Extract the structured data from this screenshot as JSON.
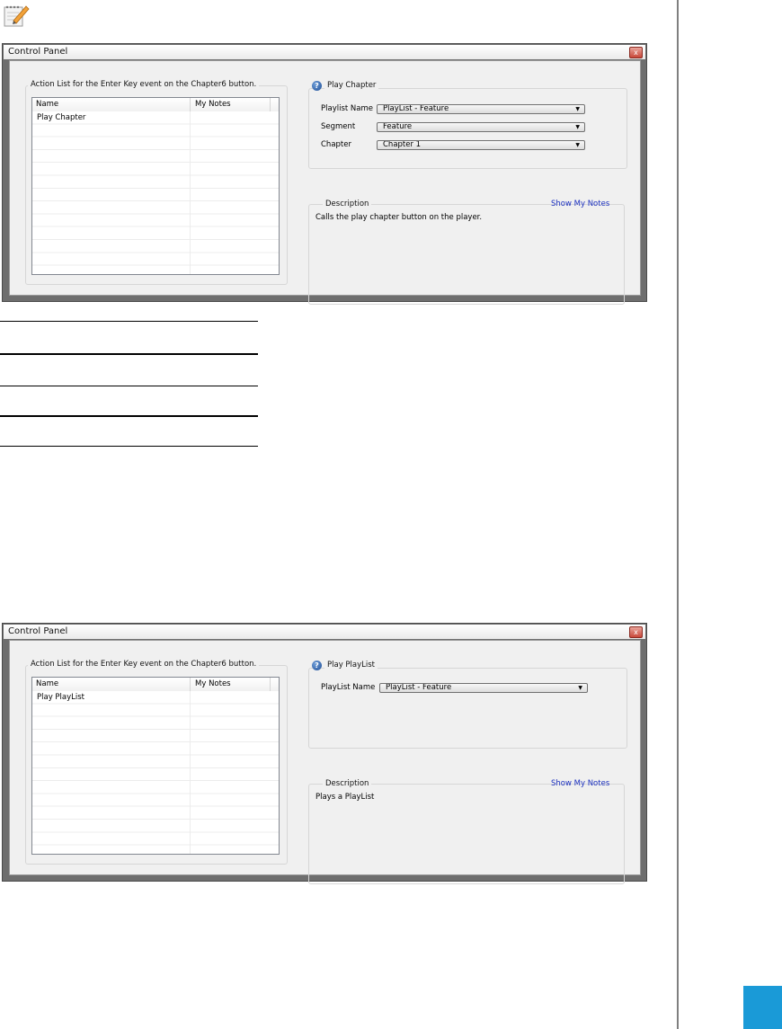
{
  "colors": {
    "accent_square": "#1a9ad7",
    "link_blue": "#1a2fbf"
  },
  "icons": {
    "note_icon": "note-pencil-icon",
    "help_icon": "question-circle-icon",
    "close_icon": "close-icon"
  },
  "dialogs": [
    {
      "title": "Control Panel",
      "close_glyph": "x",
      "action_list_group_label": "Action List for the Enter Key event on the Chapter6 button.",
      "table": {
        "columns": [
          "Name",
          "My Notes"
        ],
        "rows": [
          {
            "name": "Play Chapter",
            "notes": ""
          }
        ]
      },
      "action_group": {
        "help_glyph": "?",
        "title": "Play Chapter",
        "fields": [
          {
            "label": "Playlist Name",
            "value": "PlayList - Feature"
          },
          {
            "label": "Segment",
            "value": "Feature"
          },
          {
            "label": "Chapter",
            "value": "Chapter 1"
          }
        ]
      },
      "description": {
        "label": "Description",
        "text": "Calls the play chapter button on the player.",
        "show_notes_link": "Show My Notes"
      }
    },
    {
      "title": "Control Panel",
      "close_glyph": "x",
      "action_list_group_label": "Action List for the Enter Key event on the Chapter6 button.",
      "table": {
        "columns": [
          "Name",
          "My Notes"
        ],
        "rows": [
          {
            "name": "Play PlayList",
            "notes": ""
          }
        ]
      },
      "action_group": {
        "help_glyph": "?",
        "title": "Play PlayList",
        "fields": [
          {
            "label": "PlayList Name",
            "value": "PlayList - Feature"
          }
        ]
      },
      "description": {
        "label": "Description",
        "text": "Plays a PlayList",
        "show_notes_link": "Show My Notes"
      }
    }
  ]
}
